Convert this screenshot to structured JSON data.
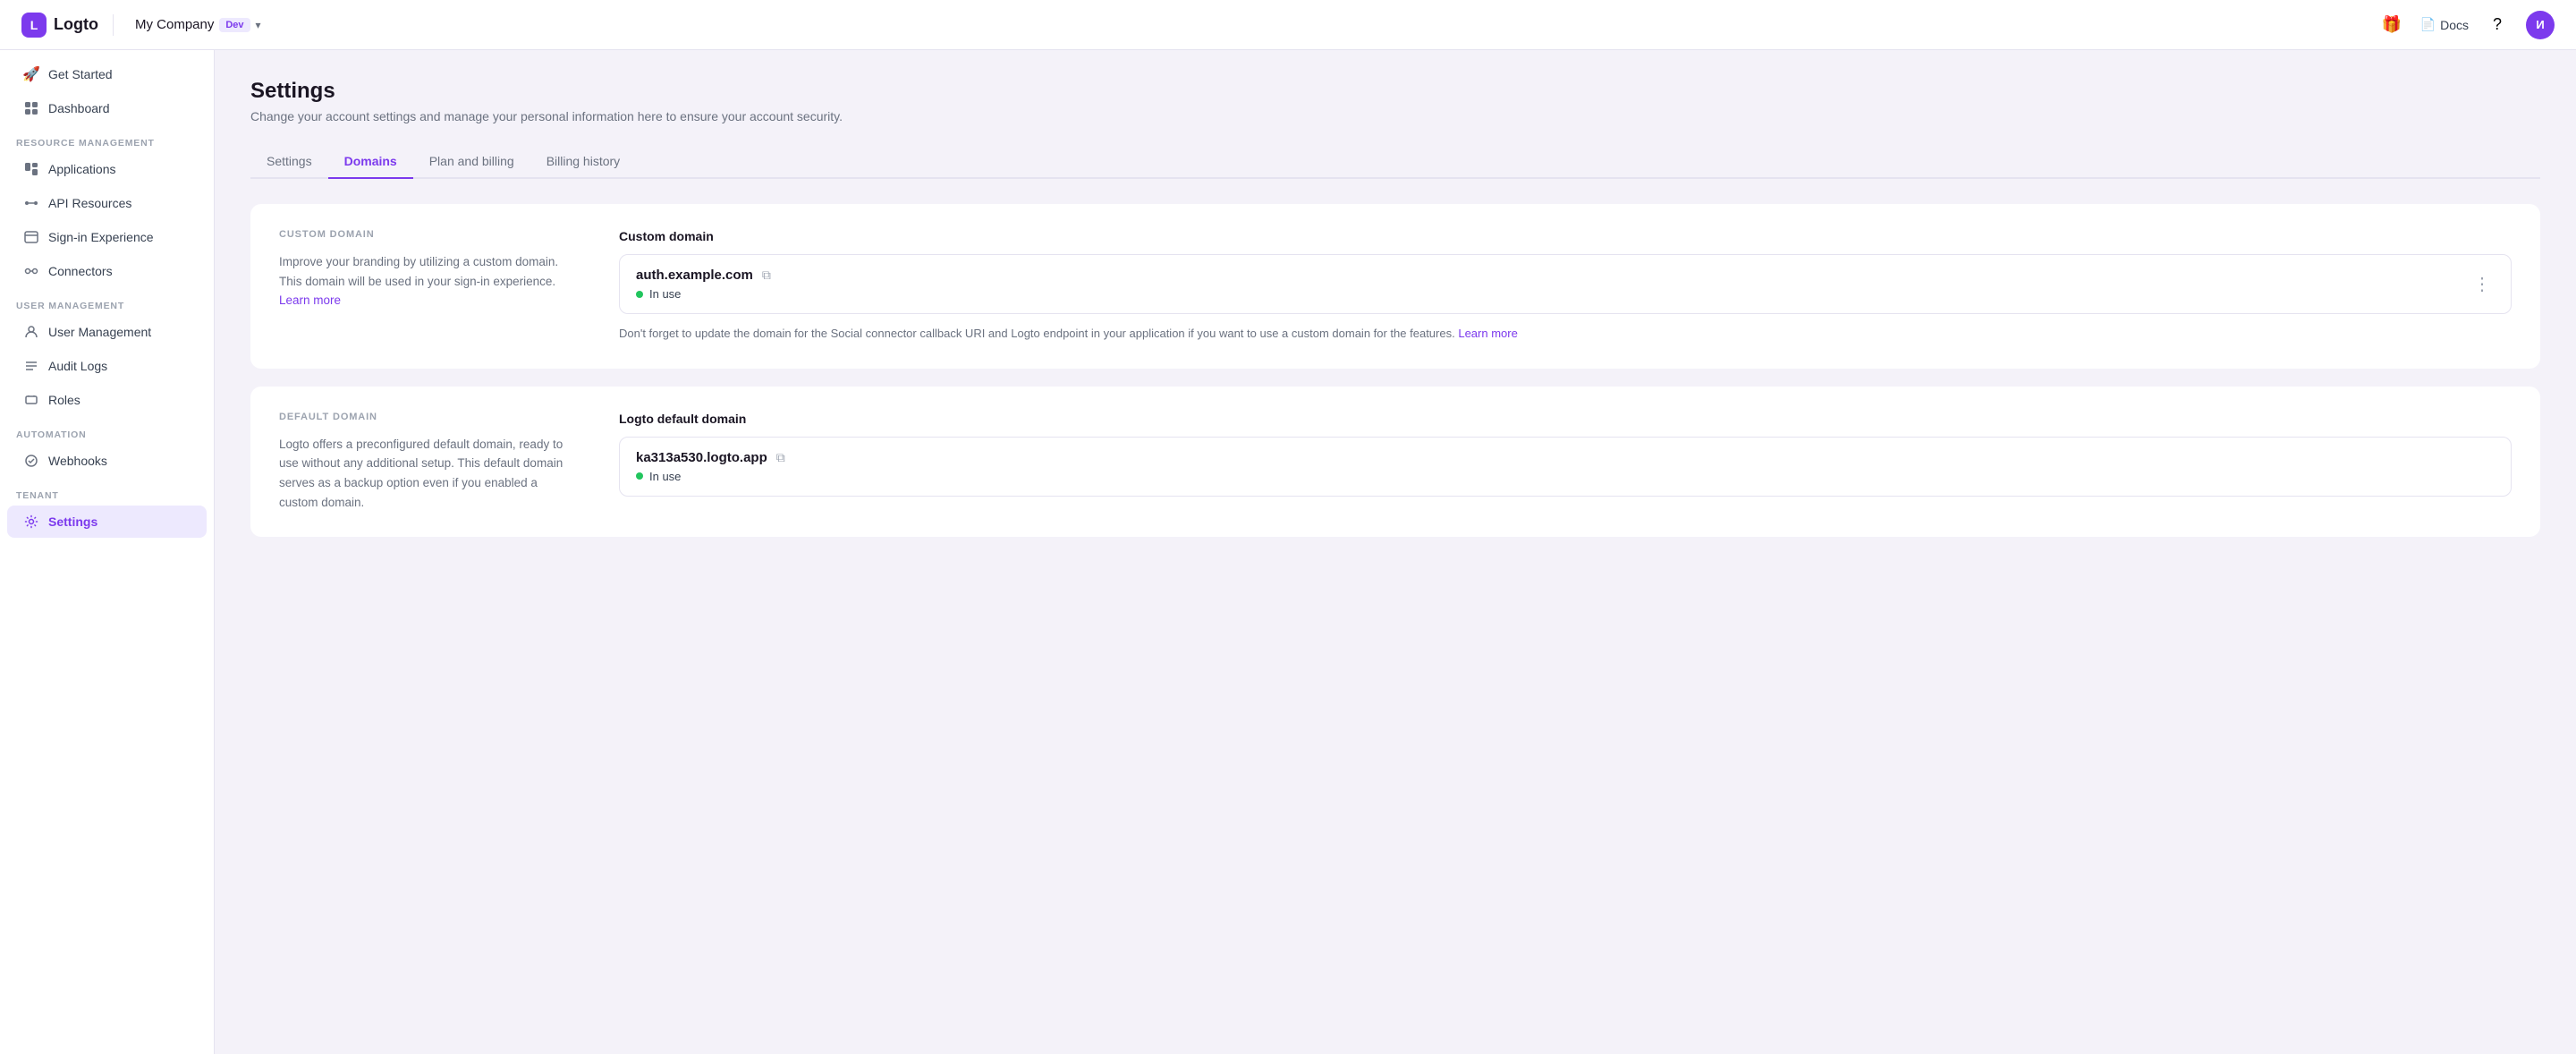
{
  "topnav": {
    "logo_label": "Logto",
    "company_name": "My Company",
    "dev_badge": "Dev",
    "docs_label": "Docs",
    "avatar_initials": "И"
  },
  "sidebar": {
    "sections": [
      {
        "items": [
          {
            "id": "get-started",
            "label": "Get Started",
            "icon": "🚀"
          },
          {
            "id": "dashboard",
            "label": "Dashboard",
            "icon": "📊"
          }
        ]
      },
      {
        "label": "RESOURCE MANAGEMENT",
        "items": [
          {
            "id": "applications",
            "label": "Applications",
            "icon": "🗂"
          },
          {
            "id": "api-resources",
            "label": "API Resources",
            "icon": "🔗"
          },
          {
            "id": "sign-in-experience",
            "label": "Sign-in Experience",
            "icon": "🖥"
          },
          {
            "id": "connectors",
            "label": "Connectors",
            "icon": "🔌"
          }
        ]
      },
      {
        "label": "USER MANAGEMENT",
        "items": [
          {
            "id": "user-management",
            "label": "User Management",
            "icon": "👤"
          },
          {
            "id": "audit-logs",
            "label": "Audit Logs",
            "icon": "☰"
          },
          {
            "id": "roles",
            "label": "Roles",
            "icon": "🪪"
          }
        ]
      },
      {
        "label": "AUTOMATION",
        "items": [
          {
            "id": "webhooks",
            "label": "Webhooks",
            "icon": "⚙"
          }
        ]
      },
      {
        "label": "TENANT",
        "items": [
          {
            "id": "settings",
            "label": "Settings",
            "icon": "⚙",
            "active": true
          }
        ]
      }
    ]
  },
  "page": {
    "title": "Settings",
    "subtitle": "Change your account settings and manage your personal information here to ensure your account security."
  },
  "tabs": [
    {
      "id": "settings",
      "label": "Settings",
      "active": false
    },
    {
      "id": "domains",
      "label": "Domains",
      "active": true
    },
    {
      "id": "plan-billing",
      "label": "Plan and billing",
      "active": false
    },
    {
      "id": "billing-history",
      "label": "Billing history",
      "active": false
    }
  ],
  "custom_domain_section": {
    "section_label": "CUSTOM DOMAIN",
    "description": "Improve your branding by utilizing a custom domain. This domain will be used in your sign-in experience.",
    "learn_more_label": "Learn more",
    "right_label": "Custom domain",
    "domain_name": "auth.example.com",
    "status": "In use",
    "note": "Don't forget to update the domain for the Social connector callback URI and Logto endpoint in your application if you want to use a custom domain for the features.",
    "note_link_label": "Learn more"
  },
  "default_domain_section": {
    "section_label": "DEFAULT DOMAIN",
    "description": "Logto offers a preconfigured default domain, ready to use without any additional setup. This default domain serves as a backup option even if you enabled a custom domain.",
    "right_label": "Logto default domain",
    "domain_name": "ka313a530.logto.app",
    "status": "In use"
  }
}
